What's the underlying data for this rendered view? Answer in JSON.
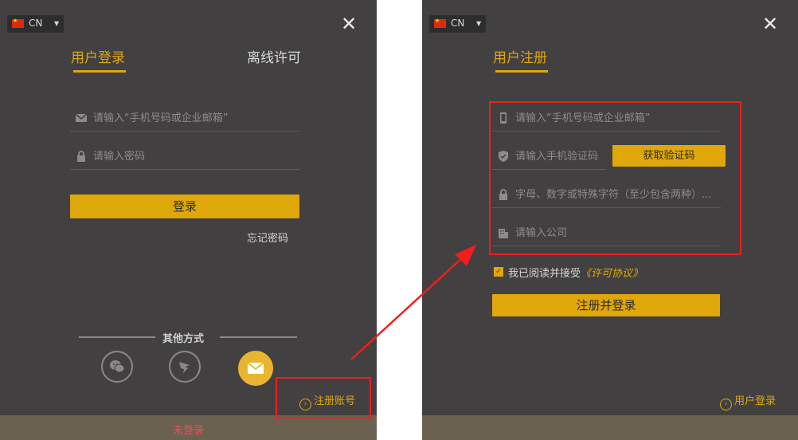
{
  "lang": {
    "code": "CN"
  },
  "login": {
    "tab_active": "用户登录",
    "tab_offline": "离线许可",
    "account_placeholder": "请输入“手机号码或企业邮箱”",
    "password_placeholder": "请输入密码",
    "login_button": "登录",
    "forgot_password": "忘记密码",
    "other_methods": "其他方式",
    "register_link": "注册账号",
    "status": "未登录"
  },
  "register": {
    "tab_active": "用户注册",
    "phone_placeholder": "请输入“手机号码或企业邮箱”",
    "code_placeholder": "请输入手机验证码",
    "get_code_button": "获取验证码",
    "password_placeholder": "字母、数字或特殊字符（至少包含两种）...",
    "company_placeholder": "请输入公司",
    "agree_text": "我已阅读并接受",
    "license_link": "《许可协议》",
    "register_button": "注册并登录",
    "login_link": "用户登录"
  },
  "colors": {
    "panel_bg": "#424040",
    "accent": "#e0a70b",
    "annotation_red": "#f41d1d",
    "status_text": "#f05050"
  },
  "icons": [
    "flag-cn-icon",
    "caret-down-icon",
    "close-icon",
    "mail-icon",
    "lock-icon",
    "wechat-icon",
    "dingtalk-icon",
    "email-icon",
    "phone-icon",
    "shield-icon",
    "building-icon",
    "chevron-circle-icon",
    "check-icon"
  ]
}
